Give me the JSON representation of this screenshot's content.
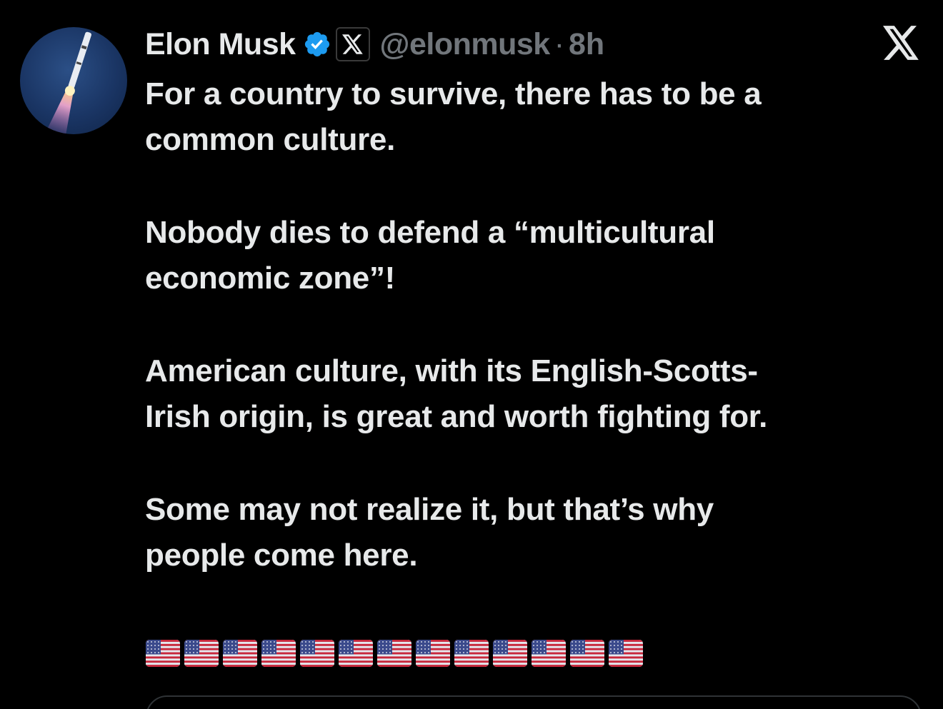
{
  "author": {
    "name": "Elon Musk",
    "handle": "@elonmusk",
    "separator": "·",
    "time": "8h",
    "verified_icon": "verified-badge-icon",
    "affiliate_icon": "x-affiliate-icon"
  },
  "platform_logo": "x-logo-icon",
  "tweet": {
    "paragraphs": [
      [
        "For a country to survive, there has to be a",
        "common culture."
      ],
      [
        "Nobody dies to defend a “multicultural",
        "economic zone”!"
      ],
      [
        "American culture, with its English-Scotts-",
        "Irish origin, is great and worth fighting for."
      ],
      [
        "Some may not realize it, but that’s why",
        "people come here."
      ]
    ],
    "flag_emoji": "🇺🇸",
    "flag_count": 13
  },
  "colors": {
    "background": "#000000",
    "text": "#e7e9ea",
    "muted": "#71767b",
    "verified": "#1d9bf0"
  }
}
